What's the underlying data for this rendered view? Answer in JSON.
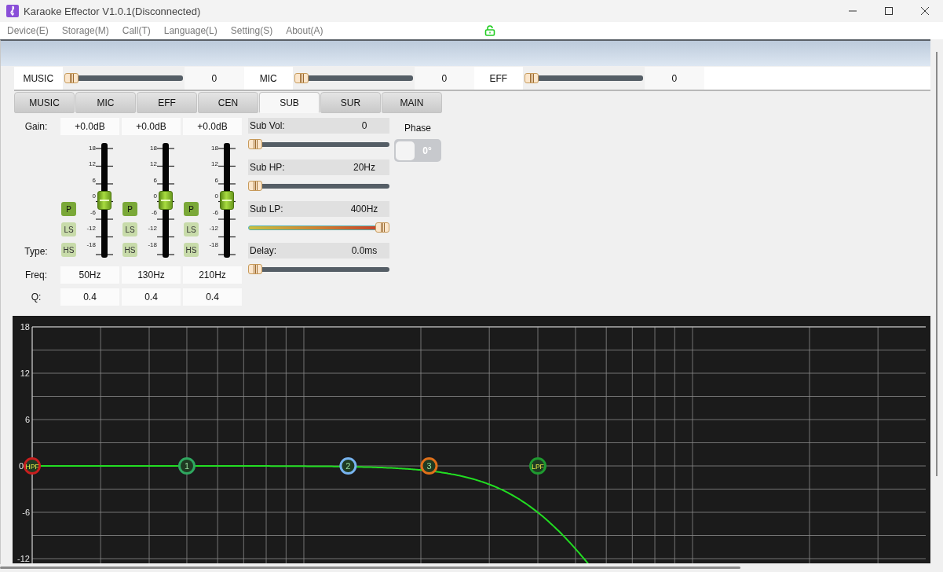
{
  "window": {
    "title": "Karaoke Effector  V1.0.1(Disconnected)"
  },
  "menu": [
    "Device(E)",
    "Storage(M)",
    "Call(T)",
    "Language(L)",
    "Setting(S)",
    "About(A)"
  ],
  "master": [
    {
      "label": "MUSIC",
      "level": 0,
      "reading": "0"
    },
    {
      "label": "MIC",
      "level": 0,
      "reading": "0"
    },
    {
      "label": "EFF",
      "level": 0,
      "reading": "0"
    }
  ],
  "tabs": [
    {
      "label": "MUSIC",
      "selected": false
    },
    {
      "label": "MIC",
      "selected": false
    },
    {
      "label": "EFF",
      "selected": false
    },
    {
      "label": "CEN",
      "selected": false
    },
    {
      "label": "SUB",
      "selected": true
    },
    {
      "label": "SUR",
      "selected": false
    },
    {
      "label": "MAIN",
      "selected": false
    }
  ],
  "eq": {
    "gain_label": "Gain:",
    "type_label": "Type:",
    "freq_label": "Freq:",
    "q_label": "Q:",
    "bands": [
      {
        "gain": "+0.0dB",
        "level": 0.5,
        "scale": [
          "18",
          "12",
          "6",
          "0",
          "-6",
          "-12",
          "-18"
        ],
        "types": [
          {
            "label": "P",
            "selected": true
          },
          {
            "label": "LS",
            "selected": false
          },
          {
            "label": "HS",
            "selected": false
          }
        ],
        "freq": "50Hz",
        "q": "0.4"
      },
      {
        "gain": "+0.0dB",
        "level": 0.5,
        "scale": [
          "18",
          "12",
          "6",
          "0",
          "-6",
          "-12",
          "-18"
        ],
        "types": [
          {
            "label": "P",
            "selected": true
          },
          {
            "label": "LS",
            "selected": false
          },
          {
            "label": "HS",
            "selected": false
          }
        ],
        "freq": "130Hz",
        "q": "0.4"
      },
      {
        "gain": "+0.0dB",
        "level": 0.5,
        "scale": [
          "18",
          "12",
          "6",
          "0",
          "-6",
          "-12",
          "-18"
        ],
        "types": [
          {
            "label": "P",
            "selected": true
          },
          {
            "label": "LS",
            "selected": false
          },
          {
            "label": "HS",
            "selected": false
          }
        ],
        "freq": "210Hz",
        "q": "0.4"
      }
    ]
  },
  "sub": [
    {
      "label": "Sub Vol:",
      "reading": "0",
      "level": 0,
      "kind": "plain"
    },
    {
      "label": "Sub HP:",
      "reading": "20Hz",
      "level": 0,
      "kind": "plain"
    },
    {
      "label": "Sub LP:",
      "reading": "400Hz",
      "level": 1,
      "kind": "gradient"
    },
    {
      "label": "Delay:",
      "reading": "0.0ms",
      "level": 0,
      "kind": "plain"
    }
  ],
  "phase": {
    "label": "Phase",
    "reading": "0°",
    "on": false
  },
  "graph": {
    "y_labels": [
      "18",
      "12",
      "6",
      "0",
      "-6",
      "-12"
    ],
    "nodes": [
      {
        "label": "HPF",
        "color": "#c81e1e"
      },
      {
        "label": "1",
        "color": "#2fa860"
      },
      {
        "label": "2",
        "color": "#78b4f0"
      },
      {
        "label": "3",
        "color": "#e0701a"
      },
      {
        "label": "LPF",
        "color": "#1f9a30"
      }
    ]
  }
}
